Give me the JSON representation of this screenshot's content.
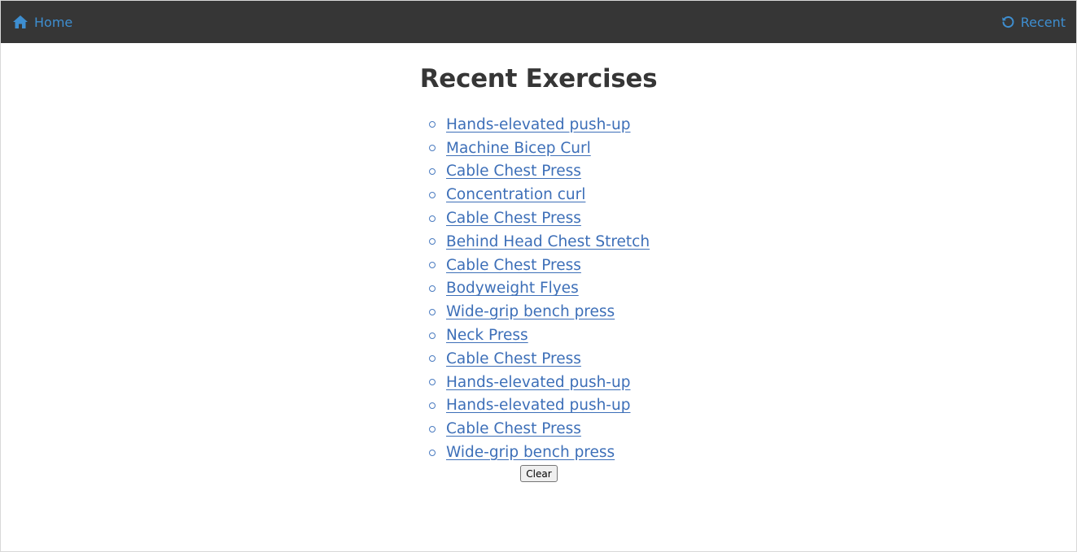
{
  "navbar": {
    "home_label": "Home",
    "home_icon": "home-icon",
    "recent_label": "Recent",
    "recent_icon": "history-icon",
    "link_color": "#3e8ed0",
    "background": "#363636"
  },
  "main": {
    "title": "Recent Exercises",
    "exercises": [
      "Hands-elevated push-up",
      "Machine Bicep Curl",
      "Cable Chest Press",
      "Concentration curl",
      "Cable Chest Press",
      "Behind Head Chest Stretch",
      "Cable Chest Press",
      "Bodyweight Flyes",
      "Wide-grip bench press",
      "Neck Press",
      "Cable Chest Press",
      "Hands-elevated push-up",
      "Hands-elevated push-up",
      "Cable Chest Press",
      "Wide-grip bench press"
    ],
    "clear_label": "Clear"
  }
}
